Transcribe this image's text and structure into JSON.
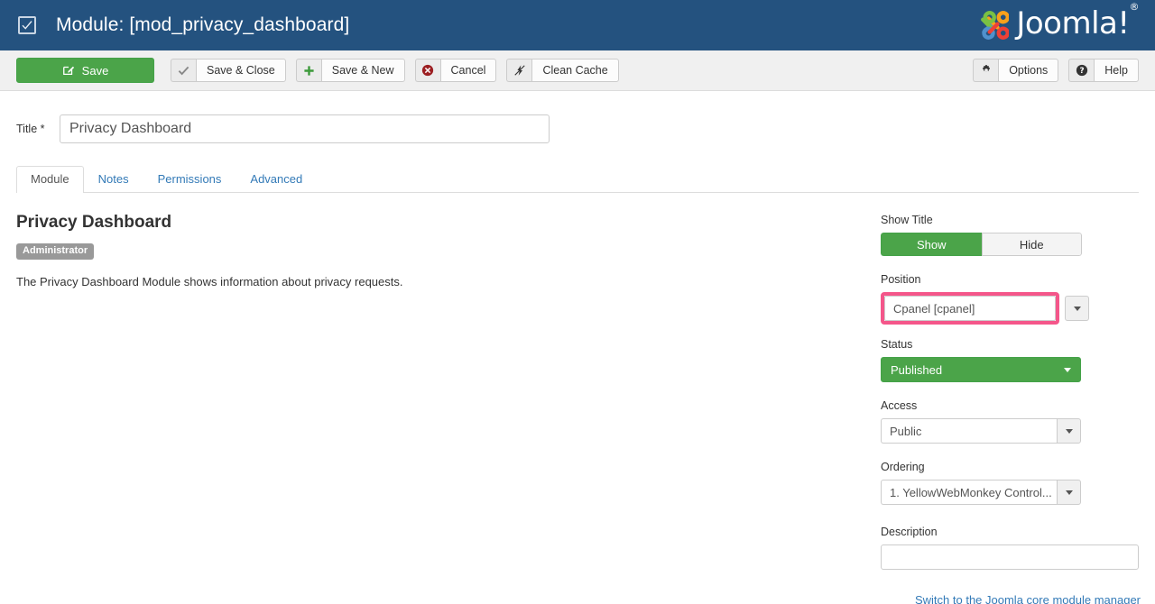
{
  "header": {
    "checkbox_icon": "checkbox-checked-icon",
    "title": "Module: [mod_privacy_dashboard]",
    "brand": "Joomla!",
    "brand_trademark": "®",
    "bar_color": "#24527f"
  },
  "toolbar": {
    "save": {
      "label": "Save",
      "icon": "edit-square-icon",
      "color": "#4ba449"
    },
    "save_close": {
      "label": "Save & Close",
      "icon": "check-icon"
    },
    "save_new": {
      "label": "Save & New",
      "icon": "plus-icon"
    },
    "cancel": {
      "label": "Cancel",
      "icon": "cancel-circle-icon"
    },
    "clean_cache": {
      "label": "Clean Cache",
      "icon": "broom-bolt-icon"
    },
    "options": {
      "label": "Options",
      "icon": "gear-icon"
    },
    "help": {
      "label": "Help",
      "icon": "question-circle-icon"
    }
  },
  "form": {
    "title_label": "Title *",
    "title_value": "Privacy Dashboard",
    "title_placeholder": ""
  },
  "tabs": [
    {
      "label": "Module",
      "active": true
    },
    {
      "label": "Notes",
      "active": false
    },
    {
      "label": "Permissions",
      "active": false
    },
    {
      "label": "Advanced",
      "active": false
    }
  ],
  "module": {
    "name": "Privacy Dashboard",
    "badge": "Administrator",
    "description": "The Privacy Dashboard Module shows information about privacy requests."
  },
  "sidebar": {
    "show_title": {
      "label": "Show Title",
      "options": [
        "Show",
        "Hide"
      ],
      "selected": "Show"
    },
    "position": {
      "label": "Position",
      "value": "Cpanel [cpanel]",
      "highlighted": true,
      "highlight_color": "#f4568a",
      "caret_icon": "chevron-down-icon"
    },
    "status": {
      "label": "Status",
      "value": "Published",
      "color": "#4ba449",
      "caret_icon": "chevron-down-icon"
    },
    "access": {
      "label": "Access",
      "value": "Public",
      "caret_icon": "chevron-down-icon"
    },
    "ordering": {
      "label": "Ordering",
      "value": "1. YellowWebMonkey Control...",
      "caret_icon": "chevron-down-icon"
    },
    "description": {
      "label": "Description",
      "value": "",
      "placeholder": ""
    },
    "switch_link": "Switch to the Joomla core module manager"
  }
}
